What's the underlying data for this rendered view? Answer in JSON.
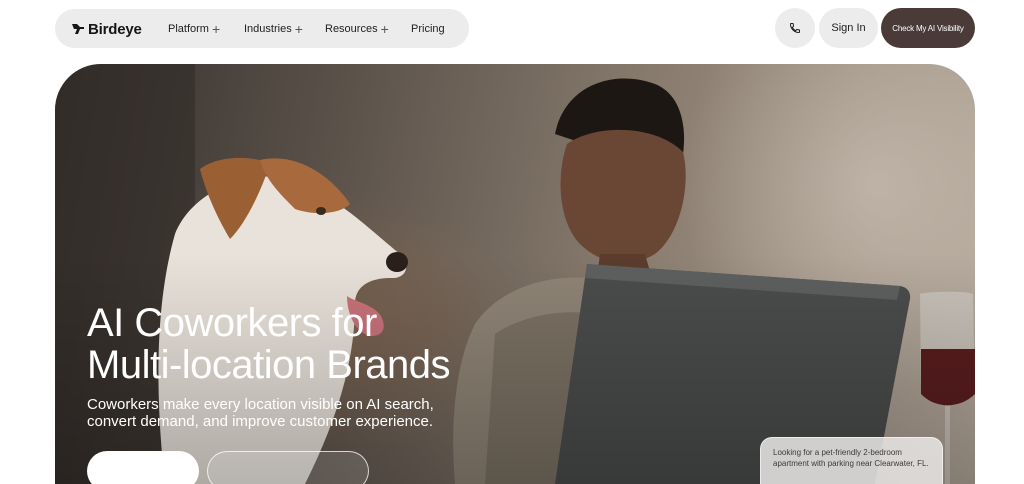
{
  "brand": {
    "name": "Birdeye"
  },
  "nav": {
    "items": [
      {
        "label": "Platform",
        "has_expand": true
      },
      {
        "label": "Industries",
        "has_expand": true
      },
      {
        "label": "Resources",
        "has_expand": true
      },
      {
        "label": "Pricing",
        "has_expand": false
      }
    ],
    "expand_glyph": "+"
  },
  "actions": {
    "phone_icon": "phone-icon",
    "sign_in": "Sign In",
    "cta": "Check My AI Visibility"
  },
  "hero": {
    "headline_line1": "AI Coworkers for",
    "headline_line2": "Multi-location Brands",
    "subtext": "Coworkers make every location visible on AI search, convert demand, and improve customer experience.",
    "chat_prompt": "Looking for a pet-friendly 2-bedroom apartment with parking near Clearwater, FL."
  },
  "colors": {
    "nav_bg": "#ececec",
    "cta_bg": "#4a3a38",
    "hero_text": "#ffffff"
  }
}
